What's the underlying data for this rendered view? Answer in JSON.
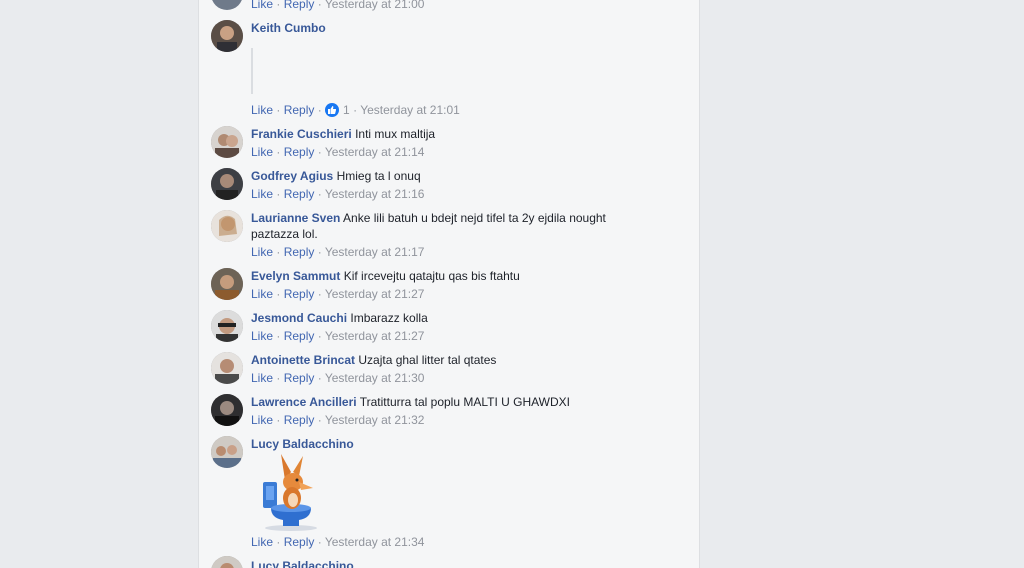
{
  "actions": {
    "like": "Like",
    "reply": "Reply",
    "sep": " · "
  },
  "comments": [
    {
      "time": "Yesterday at 21:00"
    },
    {
      "author": "Keith Cumbo",
      "text": "",
      "reaction_count": "1",
      "time": "Yesterday at 21:01"
    },
    {
      "author": "Frankie Cuschieri",
      "text": "Inti mux maltija",
      "time": "Yesterday at 21:14"
    },
    {
      "author": "Godfrey Agius",
      "text": "Hmieg ta l onuq",
      "time": "Yesterday at 21:16"
    },
    {
      "author": "Laurianne Sven",
      "text": "Anke lili batuh u bdejt nejd tifel ta 2y ejdila nought paztazza lol.",
      "time": "Yesterday at 21:17"
    },
    {
      "author": "Evelyn Sammut",
      "text": "Kif ircevejtu qatajtu qas bis ftahtu",
      "time": "Yesterday at 21:27"
    },
    {
      "author": "Jesmond Cauchi",
      "text": "Imbarazz kolla",
      "time": "Yesterday at 21:27"
    },
    {
      "author": "Antoinette Brincat",
      "text": "Uzajta ghal litter tal qtates",
      "time": "Yesterday at 21:30"
    },
    {
      "author": "Lawrence Ancilleri",
      "text": "Tratitturra tal poplu MALTI U GHAWDXI",
      "time": "Yesterday at 21:32"
    },
    {
      "author": "Lucy Baldacchino",
      "text": "",
      "sticker": "fox-on-toilet-sticker",
      "time": "Yesterday at 21:34"
    },
    {
      "author": "Lucy Baldacchino"
    }
  ],
  "colors": {
    "author": "#385898",
    "link": "#4267b2",
    "meta": "#90949c",
    "panel": "#f5f6f7",
    "page": "#e9ebee"
  }
}
